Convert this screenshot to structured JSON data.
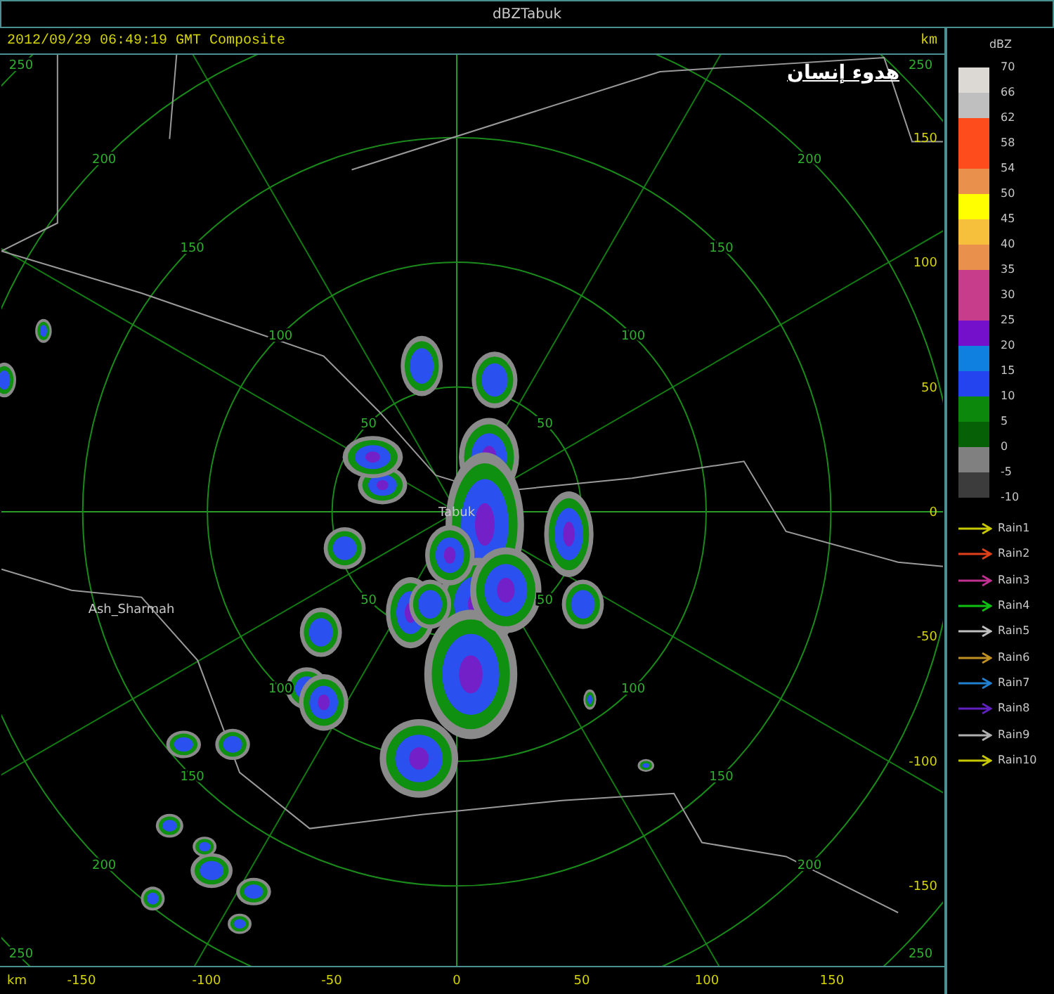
{
  "window": {
    "title": "dBZTabuk"
  },
  "header": {
    "timestamp": "2012/09/29 06:49:19 GMT Composite",
    "unit": "km"
  },
  "overlay_title": "هدوء إنسان",
  "map": {
    "rings": [
      {
        "labels": [
          "50",
          "50",
          "50",
          "50"
        ]
      },
      {
        "labels": [
          "100",
          "100",
          "100",
          "100"
        ]
      },
      {
        "labels": [
          "150",
          "150",
          "150",
          "150"
        ]
      },
      {
        "labels": [
          "200",
          "200",
          "200",
          "200"
        ]
      }
    ],
    "corner_labels": [
      "250",
      "250",
      "250",
      "250"
    ],
    "places": [
      {
        "name": "Tabuk",
        "kind": "center"
      },
      {
        "name": "Ash_Sharmah",
        "kind": "town"
      }
    ],
    "right_axis": [
      "150",
      "100",
      "50",
      "0",
      "-50",
      "-100",
      "-150"
    ],
    "bottom_axis": {
      "unit": "km",
      "ticks": [
        "-150",
        "-100",
        "-50",
        "0",
        "50",
        "100",
        "150"
      ]
    }
  },
  "legend": {
    "title": "dBZ",
    "ticks": [
      "70",
      "66",
      "62",
      "58",
      "54",
      "50",
      "45",
      "40",
      "35",
      "30",
      "25",
      "20",
      "15",
      "10",
      "5",
      "0",
      "-5",
      "-10"
    ],
    "bands": [
      {
        "color": "#dcd8d4"
      },
      {
        "color": "#bfbfbf"
      },
      {
        "color": "#ff4c1c"
      },
      {
        "color": "#ff4c1c"
      },
      {
        "color": "#e8904c"
      },
      {
        "color": "#ffff00"
      },
      {
        "color": "#f6c03c"
      },
      {
        "color": "#e8904c"
      },
      {
        "color": "#c83c8c"
      },
      {
        "color": "#c83c8c"
      },
      {
        "color": "#7410cc"
      },
      {
        "color": "#1080e0"
      },
      {
        "color": "#2444f0"
      },
      {
        "color": "#0c880c"
      },
      {
        "color": "#066006"
      },
      {
        "color": "#808080"
      },
      {
        "color": "#3c3c3c"
      }
    ]
  },
  "tracks": [
    {
      "label": "Rain1",
      "color": "#c8c800"
    },
    {
      "label": "Rain2",
      "color": "#e04018"
    },
    {
      "label": "Rain3",
      "color": "#c03090"
    },
    {
      "label": "Rain4",
      "color": "#10c010"
    },
    {
      "label": "Rain5",
      "color": "#c0c0c0"
    },
    {
      "label": "Rain6",
      "color": "#c09020"
    },
    {
      "label": "Rain7",
      "color": "#2080d0"
    },
    {
      "label": "Rain8",
      "color": "#6020c0"
    },
    {
      "label": "Rain9",
      "color": "#b0b0b0"
    },
    {
      "label": "Rain10",
      "color": "#c8c800"
    }
  ]
}
